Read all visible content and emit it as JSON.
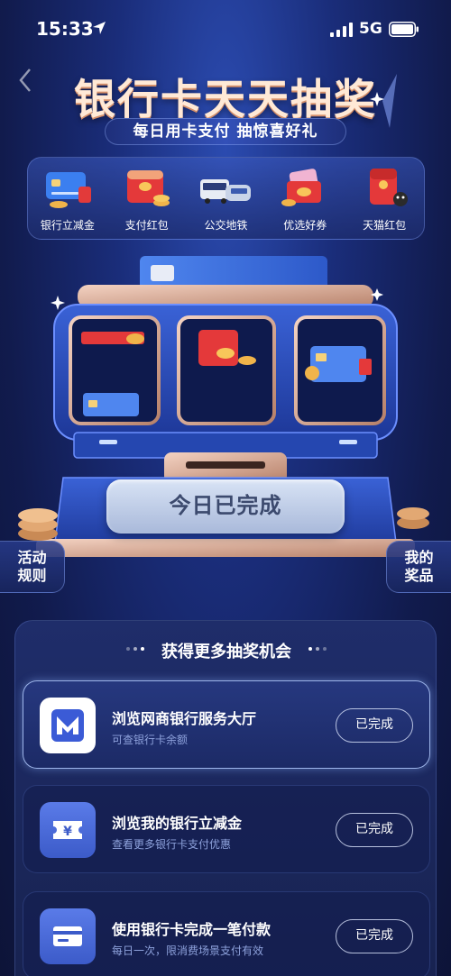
{
  "status_bar": {
    "time": "15:33",
    "network": "5G"
  },
  "header": {
    "title": "银行卡天天抽奖",
    "subtitle": "每日用卡支付 抽惊喜好礼"
  },
  "prizes": [
    {
      "label": "银行立减金",
      "icon": "card-discount-icon"
    },
    {
      "label": "支付红包",
      "icon": "red-packet-icon"
    },
    {
      "label": "公交地铁",
      "icon": "bus-train-icon"
    },
    {
      "label": "优选好券",
      "icon": "coupon-icon"
    },
    {
      "label": "天猫红包",
      "icon": "tmall-red-packet-icon"
    }
  ],
  "machine": {
    "status_button": "今日已完成",
    "rules_button": [
      "活动",
      "规则"
    ],
    "my_prizes_button": [
      "我的",
      "奖品"
    ]
  },
  "tasks_panel": {
    "title": "获得更多抽奖机会",
    "tasks": [
      {
        "title": "浏览网商银行服务大厅",
        "desc": "可查银行卡余额",
        "button": "已完成",
        "icon": "mybank-logo-icon"
      },
      {
        "title": "浏览我的银行立减金",
        "desc": "查看更多银行卡支付优惠",
        "button": "已完成",
        "icon": "yen-ticket-icon"
      },
      {
        "title": "使用银行卡完成一笔付款",
        "desc": "每日一次，限消费场景支付有效",
        "button": "已完成",
        "icon": "bank-card-icon"
      }
    ]
  },
  "colors": {
    "background": "#1a2d7a",
    "title_text": "#ffe9d6",
    "accent_blue": "#4a6fdd",
    "task_desc": "#8ea2dc"
  }
}
